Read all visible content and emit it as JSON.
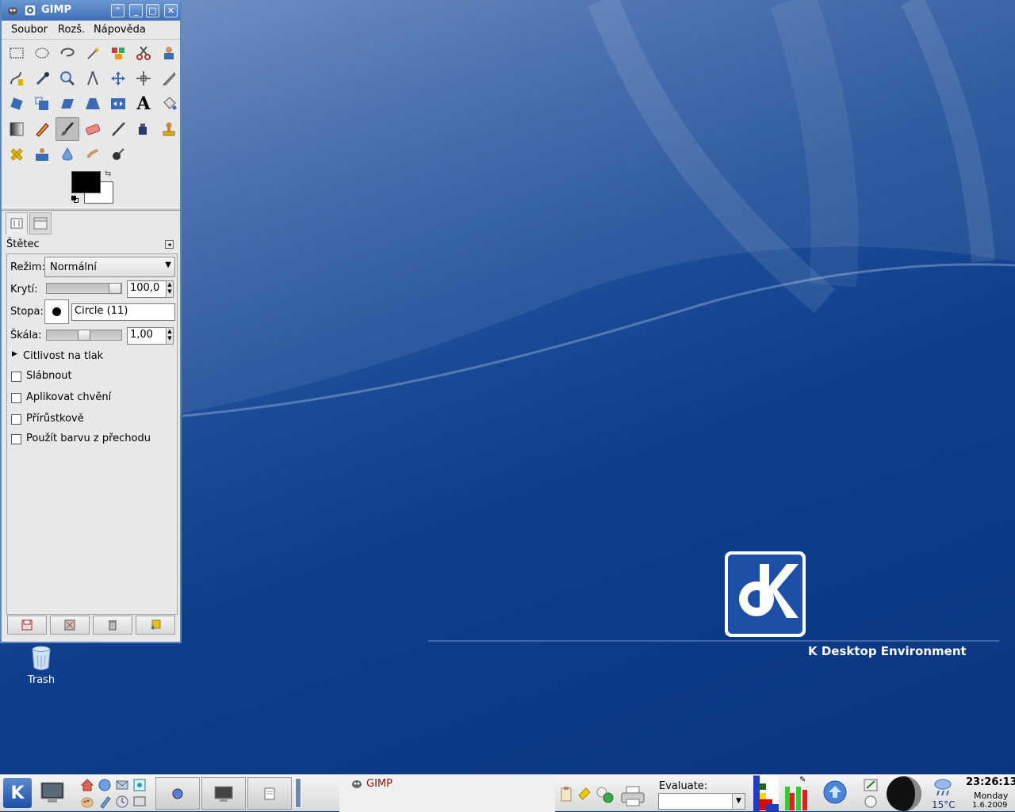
{
  "window": {
    "title": "GIMP",
    "menu": [
      "Soubor",
      "Rozš.",
      "Nápověda"
    ],
    "controls": [
      "shade-icon",
      "minimize-icon",
      "maximize-icon",
      "close-icon"
    ]
  },
  "toolbox": {
    "tools": [
      "rect-select",
      "ellipse-select",
      "free-select",
      "fuzzy-select",
      "color-select",
      "scissors-select",
      "foreground-select",
      "paths",
      "color-picker",
      "zoom",
      "measure",
      "move",
      "align",
      "crop",
      "rotate",
      "scale",
      "shear",
      "perspective",
      "flip",
      "text",
      "bucket-fill",
      "blend",
      "pencil",
      "paintbrush",
      "eraser",
      "airbrush",
      "ink",
      "clone",
      "heal",
      "perspective-clone",
      "blur",
      "smudge",
      "dodge-burn"
    ],
    "selected_tool": "paintbrush",
    "fg_color": "#000000",
    "bg_color": "#ffffff"
  },
  "tool_options": {
    "title": "Štětec",
    "mode_label": "Režim:",
    "mode_value": "Normální",
    "opacity_label": "Krytí:",
    "opacity_value": "100,0",
    "opacity_fraction": 1.0,
    "brush_label": "Stopa:",
    "brush_value": "Circle (11)",
    "scale_label": "Škála:",
    "scale_value": "1,00",
    "scale_fraction": 0.5,
    "pressure_label": "Citlivost na tlak",
    "checkboxes": [
      {
        "label": "Slábnout",
        "checked": false
      },
      {
        "label": "Aplikovat chvění",
        "checked": false
      },
      {
        "label": "Přírůstkově",
        "checked": false
      },
      {
        "label": "Použít barvu z přechodu",
        "checked": false
      }
    ],
    "bottom_buttons": [
      "save-options-icon",
      "restore-options-icon",
      "delete-options-icon",
      "reset-options-icon"
    ]
  },
  "desktop": {
    "trash_label": "Trash",
    "logo_text": "K Desktop Environment"
  },
  "taskbar": {
    "gimp_task_label": "GIMP",
    "evaluate_label": "Evaluate:",
    "evaluate_value": "",
    "temperature": "15°C",
    "time": "23:26:13",
    "day": "Monday",
    "date": "1.6.2009"
  },
  "colors": {
    "titlebar": "#4a7ac2",
    "desktop_bg": "#0b3580",
    "gimp_task_text": "#8a1010"
  }
}
